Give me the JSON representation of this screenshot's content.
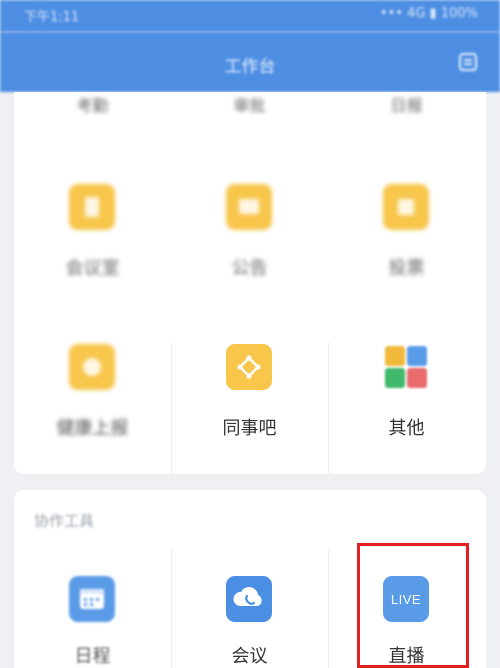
{
  "status_bar": {
    "time": "下午1:11",
    "system": "••• 4G ▮ 100%"
  },
  "header": {
    "title": "工作台",
    "menu_icon": "list-icon",
    "color": "#4d8ee3"
  },
  "apps_partial_row": {
    "labels": [
      "考勤",
      "审批",
      "日报"
    ]
  },
  "apps_row2": [
    {
      "label": "会议室",
      "icon": "door-icon",
      "color": "#f7c64a"
    },
    {
      "label": "公告",
      "icon": "mail-icon",
      "color": "#f7c64a"
    },
    {
      "label": "投票",
      "icon": "vote-icon",
      "color": "#f7c64a"
    }
  ],
  "apps_row3": [
    {
      "label": "健康上报",
      "icon": "health-icon",
      "color": "#f7c64a"
    },
    {
      "label": "同事吧",
      "icon": "colleague-icon",
      "color": "#f7c64a"
    },
    {
      "label": "其他",
      "icon": "apps-grid-icon",
      "colors": [
        "#f0b93a",
        "#5a9be8",
        "#41b86c",
        "#e96b6b"
      ]
    }
  ],
  "office_tools": {
    "title": "协作工具",
    "items": [
      {
        "label": "日程",
        "icon": "calendar-icon",
        "color": "#5a9be8"
      },
      {
        "label": "会议",
        "icon": "cloud-phone-icon",
        "color": "#4a8fe3"
      },
      {
        "label": "直播",
        "icon": "live-icon",
        "icon_text": "LIVE",
        "color": "#5a9be8"
      }
    ]
  },
  "highlight_color": "#e02020"
}
